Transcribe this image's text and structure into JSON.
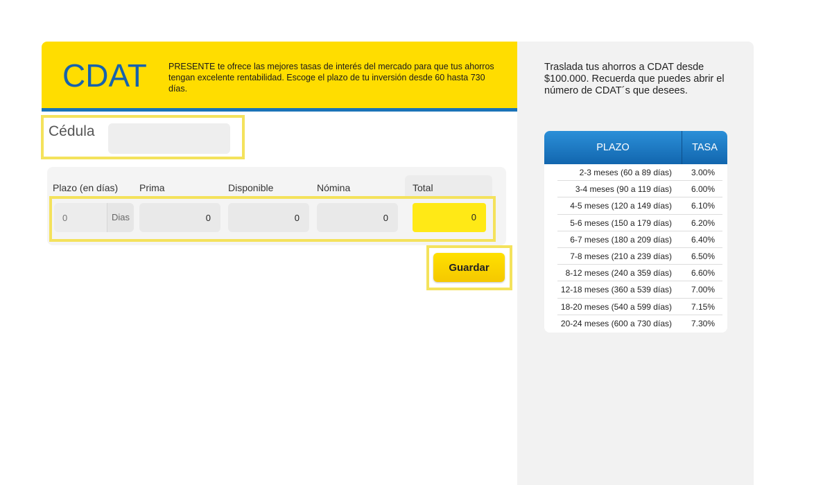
{
  "header": {
    "title": "CDAT",
    "description": "PRESENTE te ofrece las mejores tasas de interés del mercado para que tus ahorros tengan excelente rentabilidad. Escoge el plazo de tu inversión desde 60 hasta 730 días."
  },
  "form": {
    "cedula_label": "Cédula",
    "cedula_value": ""
  },
  "calc": {
    "columns": {
      "plazo": "Plazo (en días)",
      "prima": "Prima",
      "disponible": "Disponible",
      "nomina": "Nómina",
      "total": "Total"
    },
    "plazo_placeholder": "0",
    "dias_label": "Dias",
    "prima": "0",
    "disponible": "0",
    "nomina": "0",
    "total": "0",
    "save_label": "Guardar"
  },
  "sidebar": {
    "text": "Traslada tus ahorros a CDAT desde $100.000. Recuerda que puedes abrir el número de CDAT´s que desees.",
    "table": {
      "head_plazo": "PLAZO",
      "head_tasa": "TASA",
      "rows": [
        {
          "plazo": "2-3 meses (60 a 89 días)",
          "tasa": "3.00%"
        },
        {
          "plazo": "3-4 meses (90 a 119 días)",
          "tasa": "6.00%"
        },
        {
          "plazo": "4-5 meses (120 a 149 días)",
          "tasa": "6.10%"
        },
        {
          "plazo": "5-6 meses (150 a 179 días)",
          "tasa": "6.20%"
        },
        {
          "plazo": "6-7 meses (180 a 209 días)",
          "tasa": "6.40%"
        },
        {
          "plazo": "7-8 meses (210 a 239 días)",
          "tasa": "6.50%"
        },
        {
          "plazo": "8-12 meses (240 a 359 días)",
          "tasa": "6.60%"
        },
        {
          "plazo": "12-18 meses (360 a 539 días)",
          "tasa": "7.00%"
        },
        {
          "plazo": "18-20 meses (540 a 599 días)",
          "tasa": "7.15%"
        },
        {
          "plazo": "20-24 meses (600 a 730 días)",
          "tasa": "7.30%"
        }
      ]
    }
  },
  "colors": {
    "brand_yellow": "#ffdd00",
    "brand_blue": "#1662ad",
    "highlight": "#f4e25c",
    "total_yellow": "#ffe916"
  }
}
